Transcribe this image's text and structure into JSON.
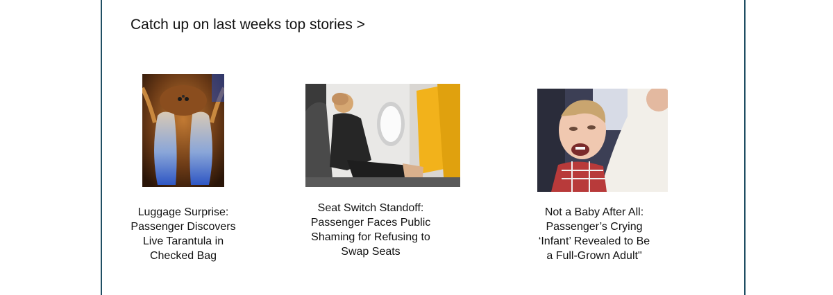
{
  "section": {
    "heading": "Catch up on last weeks top stories >"
  },
  "stories": [
    {
      "title": "Luggage Surprise: Passenger Discovers Live Tarantula in Checked Bag",
      "image": "tarantula-photo"
    },
    {
      "title": "Seat Switch Standoff: Passenger Faces Public Shaming for Refusing to Swap Seats",
      "image": "airplane-seat-passenger-photo"
    },
    {
      "title": "Not a Baby After All: Passenger’s Crying ‘Infant’ Revealed to Be a Full-Grown Adult\"",
      "image": "crying-child-photo"
    }
  ],
  "colors": {
    "frame_border": "#1f4e63"
  }
}
